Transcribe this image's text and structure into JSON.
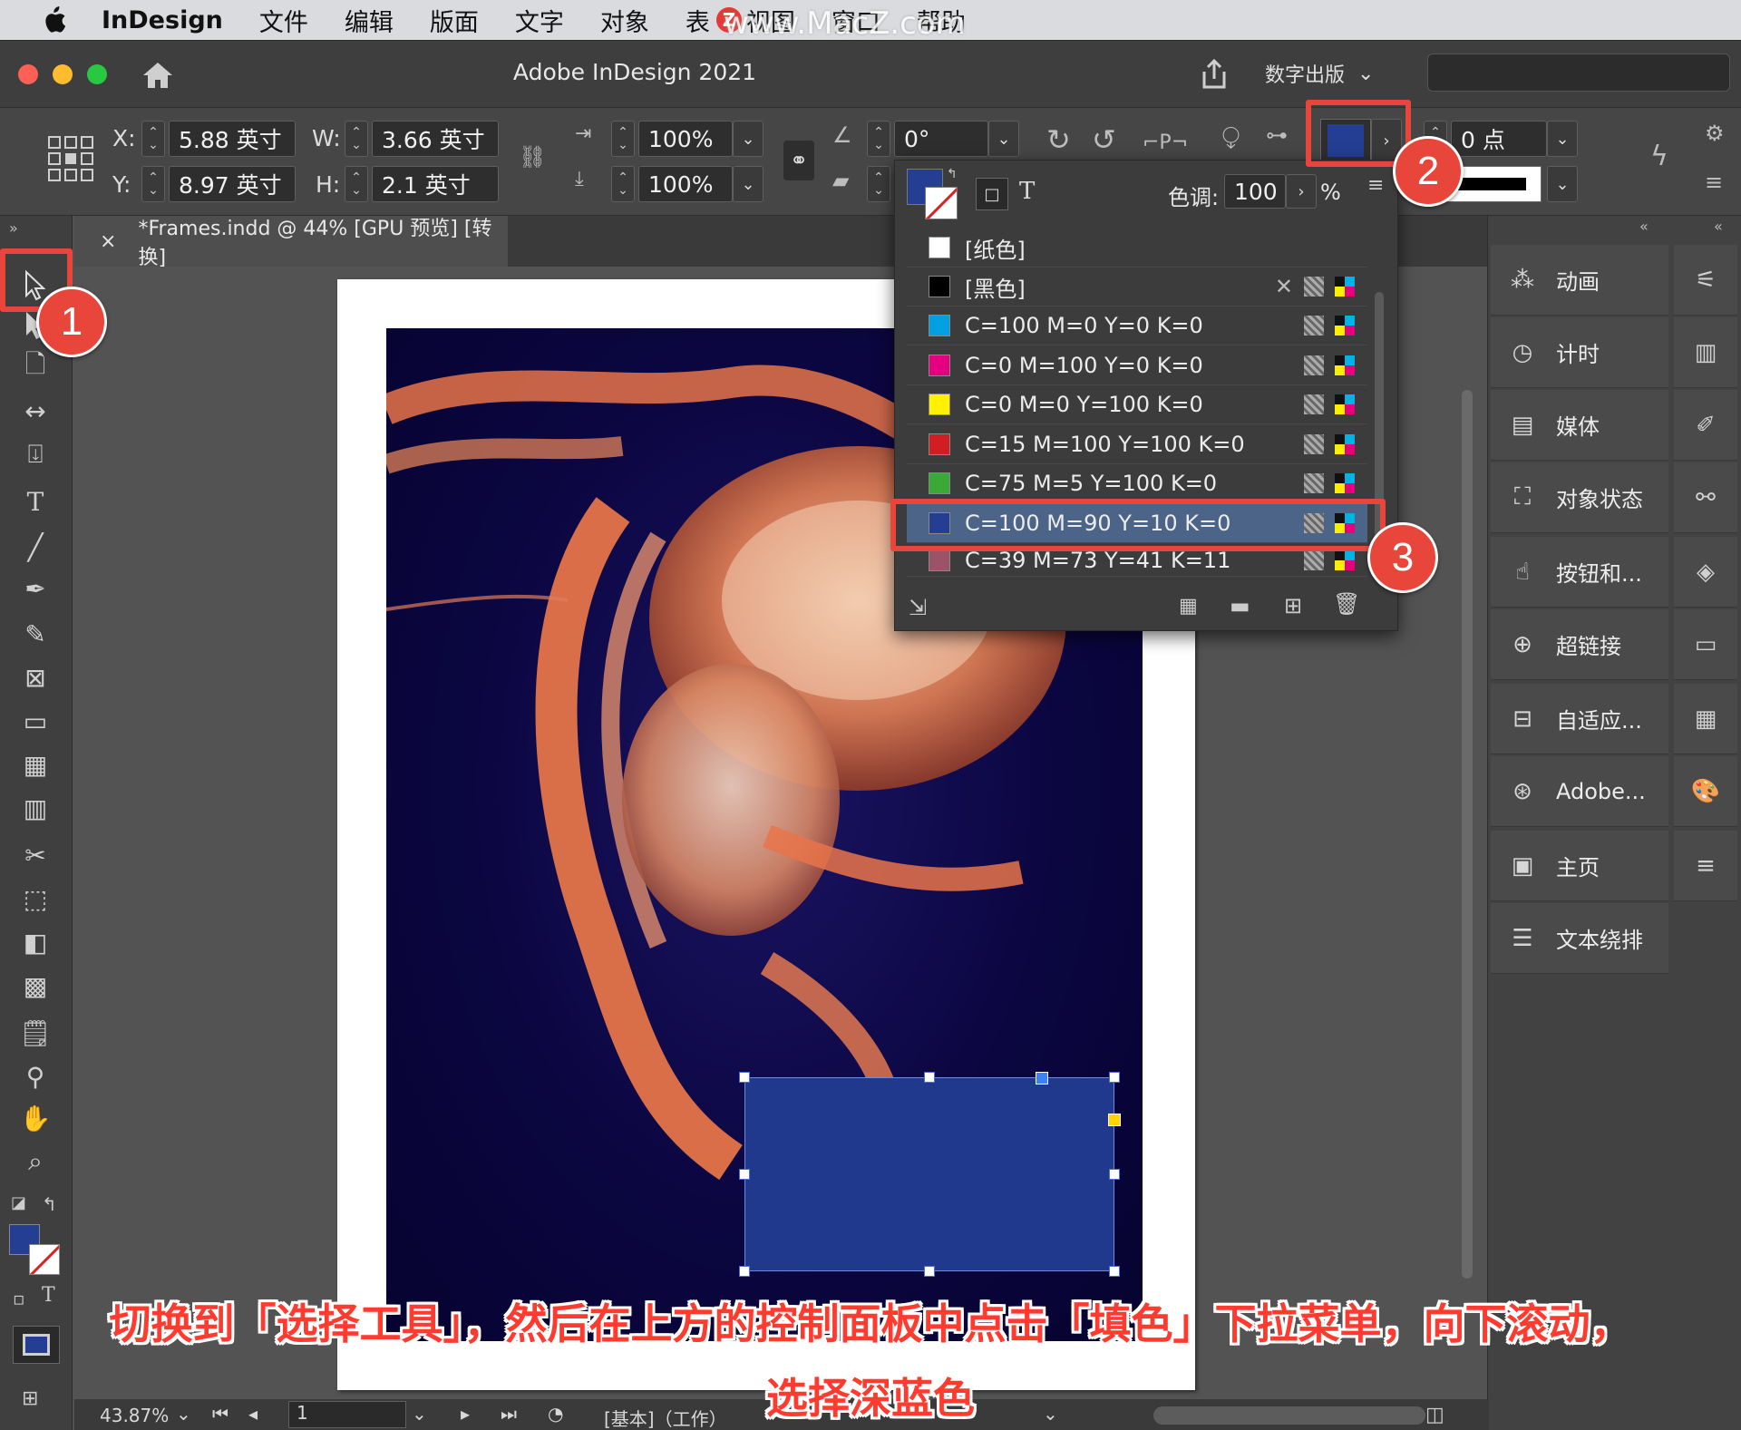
{
  "menubar": {
    "app": "InDesign",
    "items": [
      "文件",
      "编辑",
      "版面",
      "文字",
      "对象",
      "表",
      "视图",
      "窗口",
      "帮助"
    ],
    "watermark": "www.MacZ.com"
  },
  "titlebar": {
    "title": "Adobe InDesign 2021",
    "workspace": "数字出版"
  },
  "control": {
    "x_label": "X:",
    "x_value": "5.88 英寸",
    "y_label": "Y:",
    "y_value": "8.97 英寸",
    "w_label": "W:",
    "w_value": "3.66 英寸",
    "h_label": "H:",
    "h_value": "2.1 英寸",
    "scale_x": "100%",
    "scale_y": "100%",
    "rotate": "0°",
    "stroke_weight": "0 点",
    "fill_color": "#233e93"
  },
  "tab": {
    "close": "×",
    "title": "*Frames.indd @ 44% [GPU 预览] [转换]"
  },
  "swatches": {
    "tint_label": "色调:",
    "tint_value": "100",
    "percent": "%",
    "items": [
      {
        "name": "[纸色]",
        "color": "#ffffff"
      },
      {
        "name": "[黑色]",
        "color": "#000000"
      },
      {
        "name": "C=100 M=0 Y=0 K=0",
        "color": "#00a0e3"
      },
      {
        "name": "C=0 M=100 Y=0 K=0",
        "color": "#e5007f"
      },
      {
        "name": "C=0 M=0 Y=100 K=0",
        "color": "#fff100"
      },
      {
        "name": "C=15 M=100 Y=100 K=0",
        "color": "#d21d22"
      },
      {
        "name": "C=75 M=5 Y=100 K=0",
        "color": "#3aa935"
      },
      {
        "name": "C=100 M=90 Y=10 K=0",
        "color": "#233e93"
      },
      {
        "name": "C=39 M=73 Y=41 K=11",
        "color": "#9b5467"
      }
    ],
    "selected_index": 7
  },
  "right_panels": [
    {
      "label": "动画",
      "icon": "animation-icon"
    },
    {
      "label": "计时",
      "icon": "timing-icon"
    },
    {
      "label": "媒体",
      "icon": "media-icon"
    },
    {
      "label": "对象状态",
      "icon": "object-states-icon"
    },
    {
      "label": "按钮和...",
      "icon": "buttons-icon"
    },
    {
      "label": "超链接",
      "icon": "hyperlinks-icon"
    },
    {
      "label": "自适应...",
      "icon": "liquid-layout-icon"
    },
    {
      "label": "Adobe...",
      "icon": "adobe-connect-icon"
    },
    {
      "label": "主页",
      "icon": "pages-icon"
    },
    {
      "label": "文本绕排",
      "icon": "text-wrap-icon"
    }
  ],
  "statusbar": {
    "zoom": "43.87%",
    "page": "1",
    "style": "[基本]（工作）"
  },
  "annotations": {
    "badge1": "1",
    "badge2": "2",
    "badge3": "3"
  },
  "caption": {
    "line1": "切换到「选择工具」，然后在上方的控制面板中点击「填色」下拉菜单，向下滚动，",
    "line2": "选择深蓝色"
  }
}
